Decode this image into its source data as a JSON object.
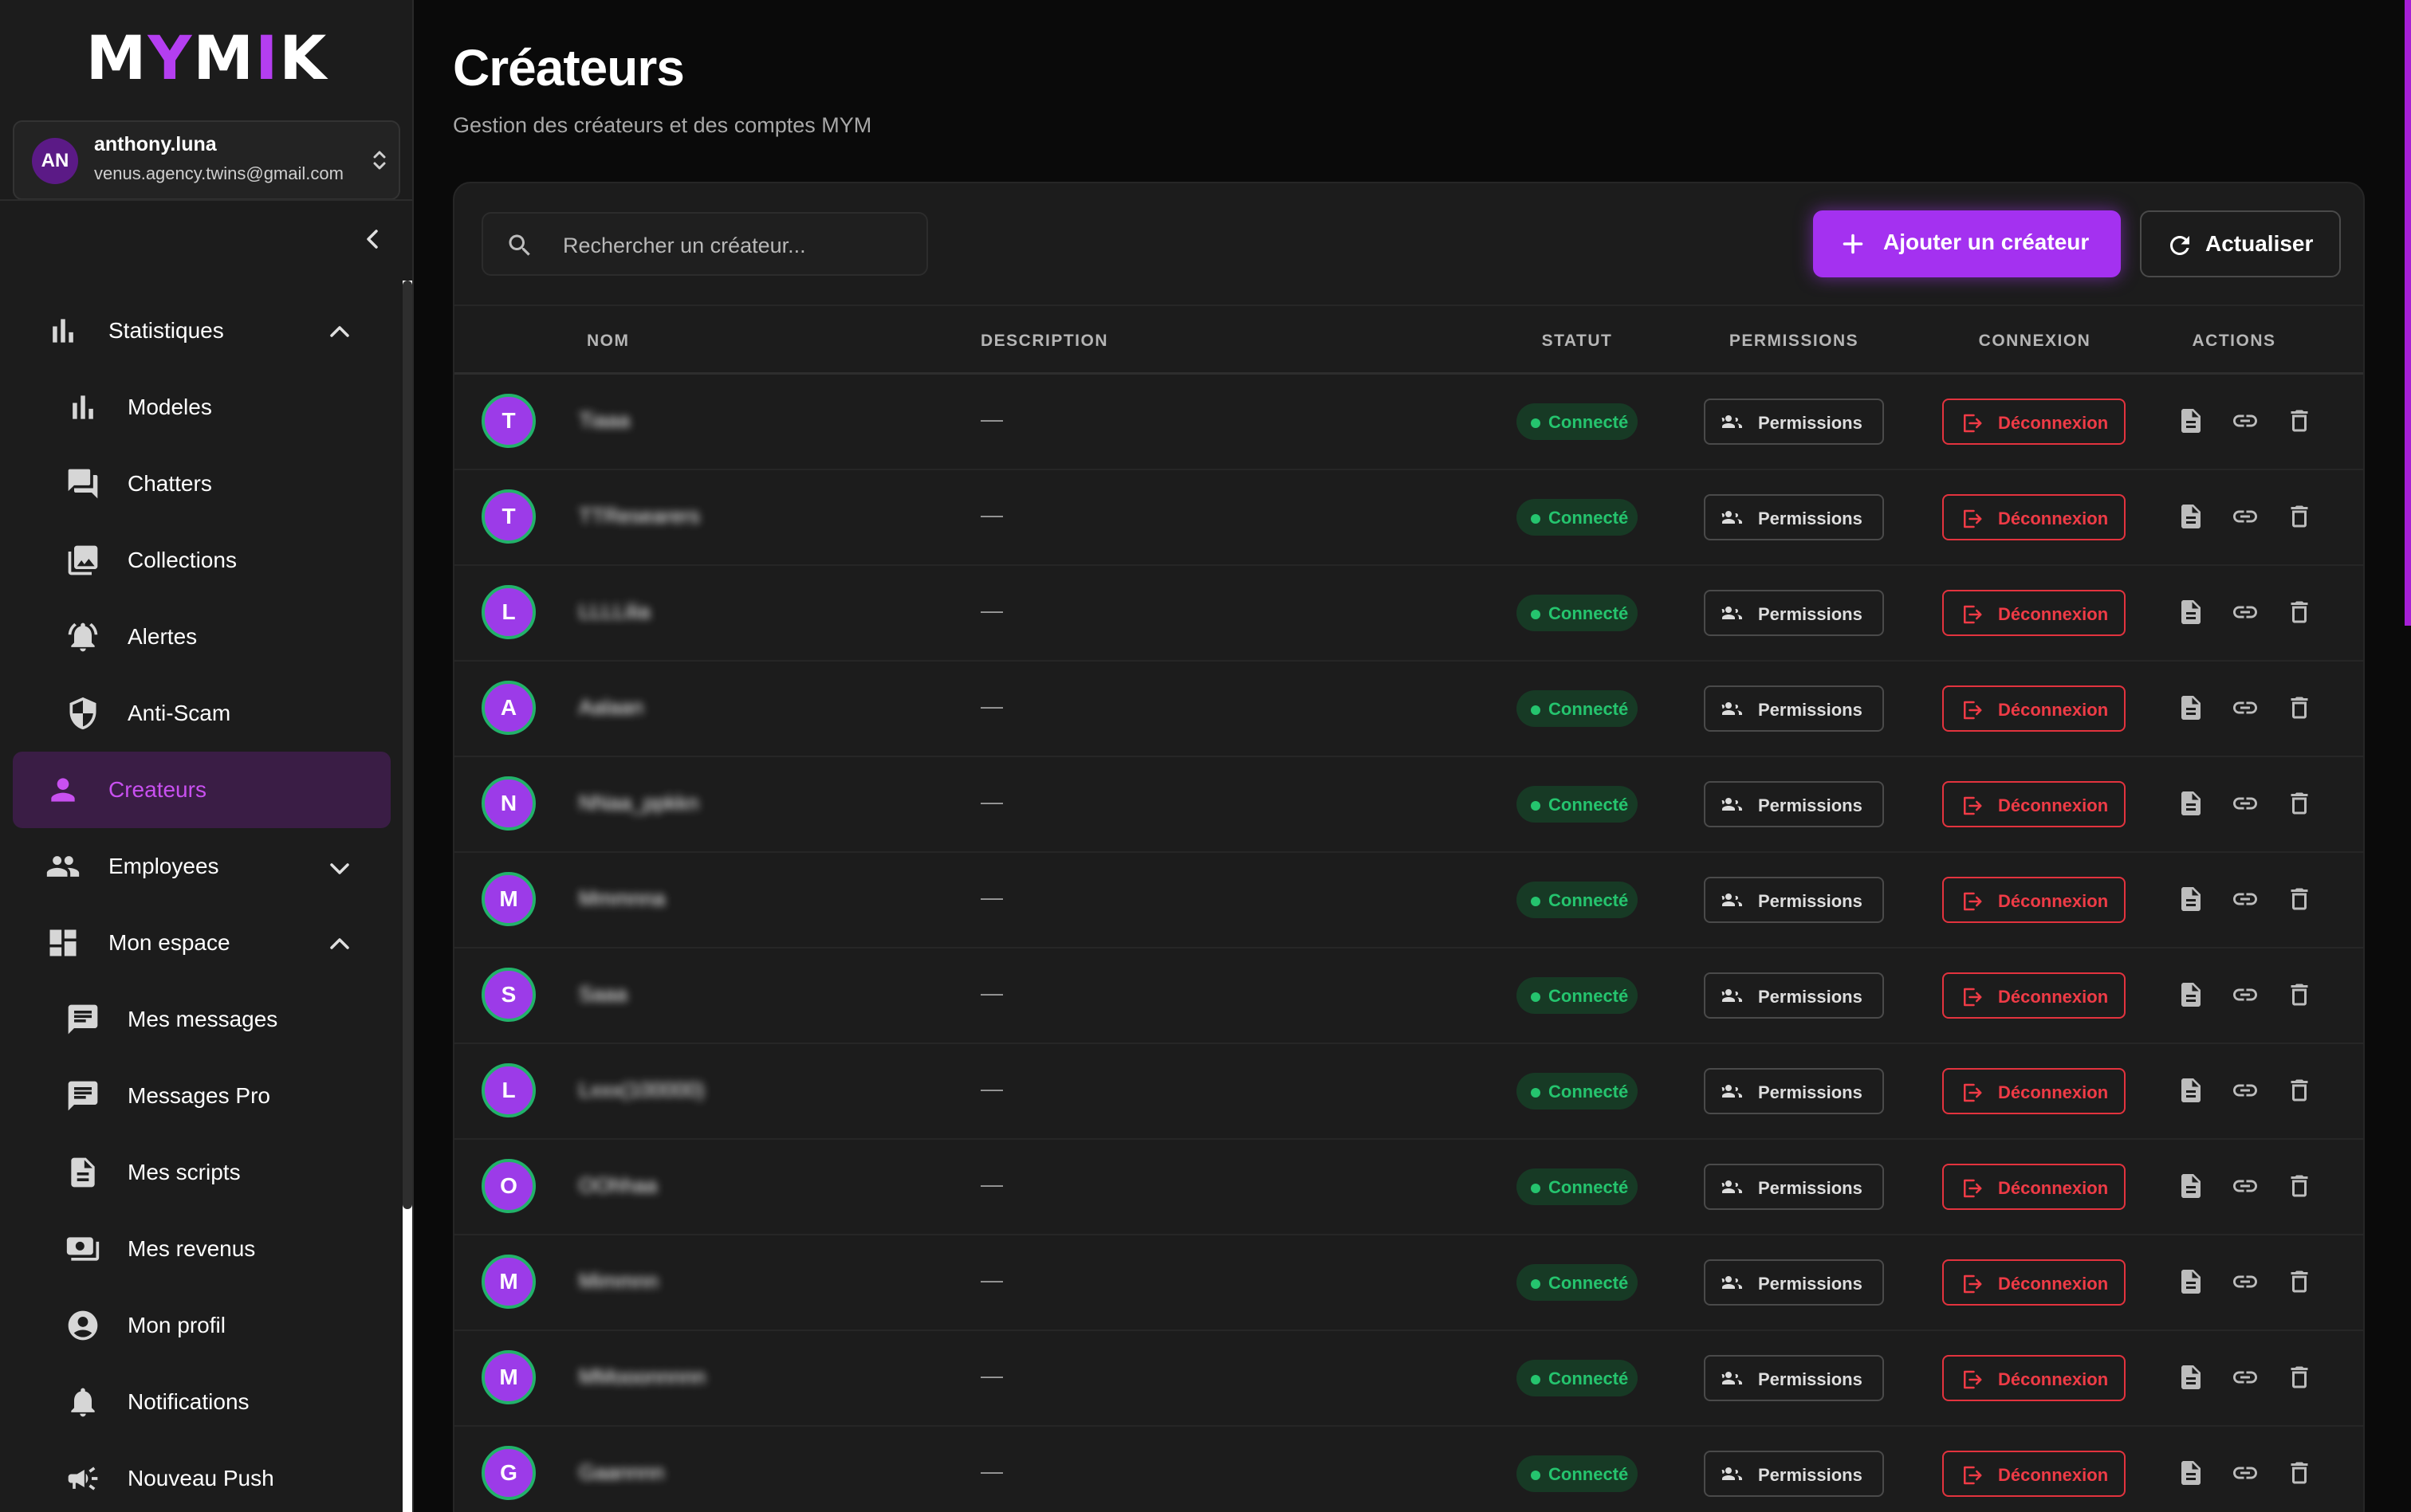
{
  "app": {
    "logo": {
      "parts": [
        "M",
        "Y",
        "M",
        "I",
        "K"
      ],
      "accent_color": "#b43ef0"
    }
  },
  "account": {
    "initials": "AN",
    "name": "anthony.luna",
    "email": "venus.agency.twins@gmail.com"
  },
  "sidebar": {
    "items": [
      {
        "label": "Statistiques",
        "icon": "bar-chart-icon",
        "level": "top",
        "expanded": true
      },
      {
        "label": "Modeles",
        "icon": "bar-chart-icon",
        "level": "sub"
      },
      {
        "label": "Chatters",
        "icon": "forum-icon",
        "level": "sub"
      },
      {
        "label": "Collections",
        "icon": "photo-library-icon",
        "level": "sub"
      },
      {
        "label": "Alertes",
        "icon": "alarm-bell-icon",
        "level": "sub"
      },
      {
        "label": "Anti-Scam",
        "icon": "shield-icon",
        "level": "sub"
      },
      {
        "label": "Createurs",
        "icon": "person-icon",
        "level": "top",
        "active": true
      },
      {
        "label": "Employees",
        "icon": "people-icon",
        "level": "top",
        "expanded": false
      },
      {
        "label": "Mon espace",
        "icon": "dashboard-icon",
        "level": "top",
        "expanded": true
      },
      {
        "label": "Mes messages",
        "icon": "message-icon",
        "level": "sub"
      },
      {
        "label": "Messages Pro",
        "icon": "message-icon",
        "level": "sub"
      },
      {
        "label": "Mes scripts",
        "icon": "document-icon",
        "level": "sub"
      },
      {
        "label": "Mes revenus",
        "icon": "payments-icon",
        "level": "sub"
      },
      {
        "label": "Mon profil",
        "icon": "account-circle-icon",
        "level": "sub"
      },
      {
        "label": "Notifications",
        "icon": "bell-icon",
        "level": "sub"
      },
      {
        "label": "Nouveau Push",
        "icon": "megaphone-icon",
        "level": "sub"
      }
    ]
  },
  "page": {
    "title": "Créateurs",
    "subtitle": "Gestion des créateurs et des comptes MYM"
  },
  "toolbar": {
    "search_placeholder": "Rechercher un créateur...",
    "add_label": "Ajouter un créateur",
    "refresh_label": "Actualiser"
  },
  "table": {
    "columns": {
      "nom": "NOM",
      "description": "DESCRIPTION",
      "statut": "STATUT",
      "permissions": "PERMISSIONS",
      "connexion": "CONNEXION",
      "actions": "ACTIONS"
    },
    "rows": [
      {
        "initial": "T",
        "name": "Tiaaa",
        "description": "—",
        "status": "Connecté",
        "permissions_label": "Permissions",
        "logout_label": "Déconnexion"
      },
      {
        "initial": "T",
        "name": "TTResearers",
        "description": "—",
        "status": "Connecté",
        "permissions_label": "Permissions",
        "logout_label": "Déconnexion"
      },
      {
        "initial": "L",
        "name": "LLLLilia",
        "description": "—",
        "status": "Connecté",
        "permissions_label": "Permissions",
        "logout_label": "Déconnexion"
      },
      {
        "initial": "A",
        "name": "Aalaan",
        "description": "—",
        "status": "Connecté",
        "permissions_label": "Permissions",
        "logout_label": "Déconnexion"
      },
      {
        "initial": "N",
        "name": "NNaa_ppkkn",
        "description": "—",
        "status": "Connecté",
        "permissions_label": "Permissions",
        "logout_label": "Déconnexion"
      },
      {
        "initial": "M",
        "name": "Mmmnna",
        "description": "—",
        "status": "Connecté",
        "permissions_label": "Permissions",
        "logout_label": "Déconnexion"
      },
      {
        "initial": "S",
        "name": "Saaa",
        "description": "—",
        "status": "Connecté",
        "permissions_label": "Permissions",
        "logout_label": "Déconnexion"
      },
      {
        "initial": "L",
        "name": "Lxxx(100000)",
        "description": "—",
        "status": "Connecté",
        "permissions_label": "Permissions",
        "logout_label": "Déconnexion"
      },
      {
        "initial": "O",
        "name": "OOhhaa",
        "description": "—",
        "status": "Connecté",
        "permissions_label": "Permissions",
        "logout_label": "Déconnexion"
      },
      {
        "initial": "M",
        "name": "Mimmnn",
        "description": "—",
        "status": "Connecté",
        "permissions_label": "Permissions",
        "logout_label": "Déconnexion"
      },
      {
        "initial": "M",
        "name": "MMooonnnnn",
        "description": "—",
        "status": "Connecté",
        "permissions_label": "Permissions",
        "logout_label": "Déconnexion"
      },
      {
        "initial": "G",
        "name": "Gaannnn",
        "description": "—",
        "status": "Connecté",
        "permissions_label": "Permissions",
        "logout_label": "Déconnexion"
      }
    ]
  },
  "colors": {
    "accent": "#a431f0",
    "status_connected": "#25c46e",
    "danger": "#ef3b46",
    "active_nav_bg": "#3a1d45",
    "active_nav_text": "#c850f0"
  }
}
